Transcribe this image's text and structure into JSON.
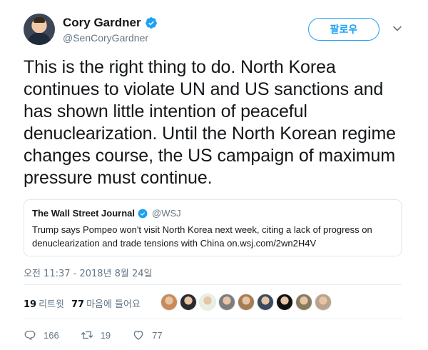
{
  "author": {
    "name": "Cory Gardner",
    "handle": "@SenCoryGardner",
    "verified": true
  },
  "follow_button": {
    "label": "팔로우"
  },
  "tweet": {
    "text": "This is the right thing to do. North Korea continues to violate UN and US sanctions and has shown little intention of peaceful denuclearization. Until the North Korean regime changes course, the US campaign of maximum pressure must continue.",
    "timestamp": "오전 11:37 - 2018년 8월 24일"
  },
  "quoted_tweet": {
    "name": "The Wall Street Journal",
    "handle": "@WSJ",
    "verified": true,
    "text": "Trump says Pompeo won't visit North Korea next week, citing a lack of progress on denuclearization and trade tensions with China on.wsj.com/2wn2H4V"
  },
  "stats": {
    "retweets_count": "19",
    "retweets_label": "리트윗",
    "likes_count": "77",
    "likes_label": "마음에 들어요"
  },
  "liker_avatars": [
    {
      "color": "#c98b5a"
    },
    {
      "color": "#2b2b2b"
    },
    {
      "color": "#e9f0e2"
    },
    {
      "color": "#7d7d7d"
    },
    {
      "color": "#a67c52"
    },
    {
      "color": "#3b4a5c"
    },
    {
      "color": "#111111"
    },
    {
      "color": "#8a7a5c"
    },
    {
      "color": "#b9a38a"
    }
  ],
  "actions": {
    "replies": "166",
    "retweets": "19",
    "likes": "77"
  },
  "colors": {
    "accent": "#1da1f2",
    "secondary_text": "#657786",
    "divider": "#e6ecf0"
  }
}
